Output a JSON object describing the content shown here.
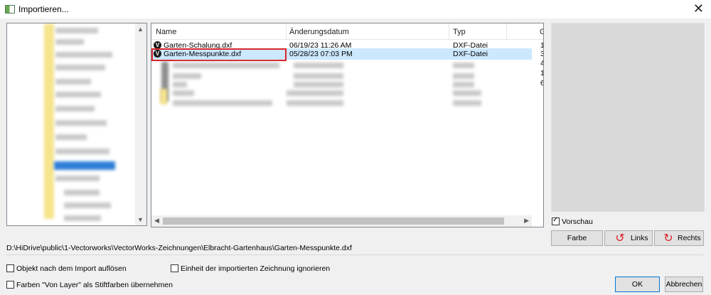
{
  "window": {
    "title": "Importieren..."
  },
  "file_list": {
    "columns": [
      "Name",
      "Änderungsdatum",
      "Typ",
      "G"
    ],
    "rows": [
      {
        "name": "Garten-Schalung.dxf",
        "date": "06/19/23 11:26 AM",
        "type": "DXF-Datei",
        "size": "1"
      },
      {
        "name": "Garten-Messpunkte.dxf",
        "date": "05/28/23 07:03 PM",
        "type": "DXF-Datei",
        "size": "3",
        "selected": true
      }
    ],
    "blurred_size_digits": [
      "4",
      "1",
      "6"
    ]
  },
  "preview": {
    "checkbox_label": "Vorschau",
    "checked": true
  },
  "preview_buttons": {
    "color": "Farbe",
    "left": "Links",
    "right": "Rechts"
  },
  "path": "D:\\HiDrive\\public\\1-Vectorworks\\VectorWorks-Zeichnungen\\Elbracht-Gartenhaus\\Garten-Messpunkte.dxf",
  "options": {
    "dissolve": "Objekt nach dem Import auflösen",
    "ignore_unit": "Einheit der importierten Zeichnung ignorieren",
    "layer_colors": "Farben \"Von Layer\" als Stiftfarben übernehmen"
  },
  "buttons": {
    "ok": "OK",
    "cancel": "Abbrechen"
  },
  "colors": {
    "selection": "#cce8ff",
    "highlight": "#d9262b",
    "accent": "#0078d7"
  }
}
